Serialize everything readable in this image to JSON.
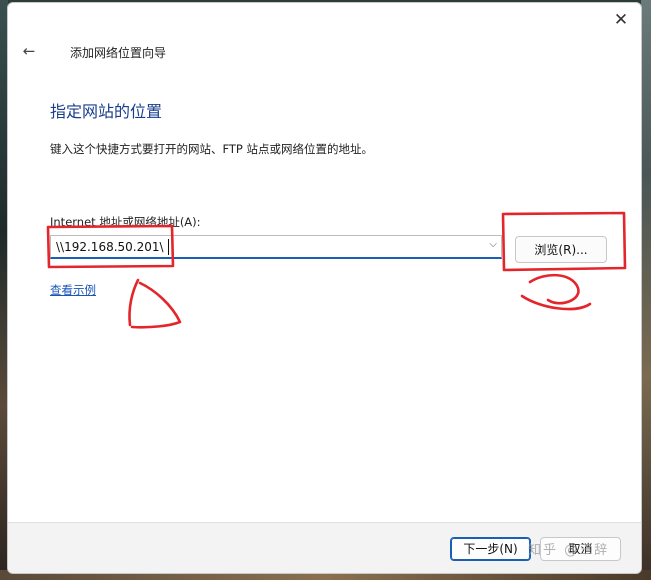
{
  "window": {
    "title": "添加网络位置向导",
    "close_glyph": "✕",
    "back_glyph": "←"
  },
  "page": {
    "heading": "指定网站的位置",
    "instruction": "键入这个快捷方式要打开的网站、FTP 站点或网络位置的地址。"
  },
  "address": {
    "label": "Internet 地址或网络地址(A):",
    "value": "\\\\192.168.50.201\\",
    "dropdown_glyph": "⌵"
  },
  "browse_button": {
    "label": "浏览(R)..."
  },
  "example_link": {
    "label": "查看示例"
  },
  "footer": {
    "next_label": "下一步(N)",
    "cancel_label": "取消"
  },
  "watermark": "知乎 @三辞",
  "annotations": {
    "color": "#e3262c",
    "marks": [
      "circled input box",
      "1",
      "circled browse button",
      "2"
    ]
  },
  "colors": {
    "heading": "#1a3e8c",
    "link": "#1a56b8",
    "focus": "#1a5fb4"
  }
}
